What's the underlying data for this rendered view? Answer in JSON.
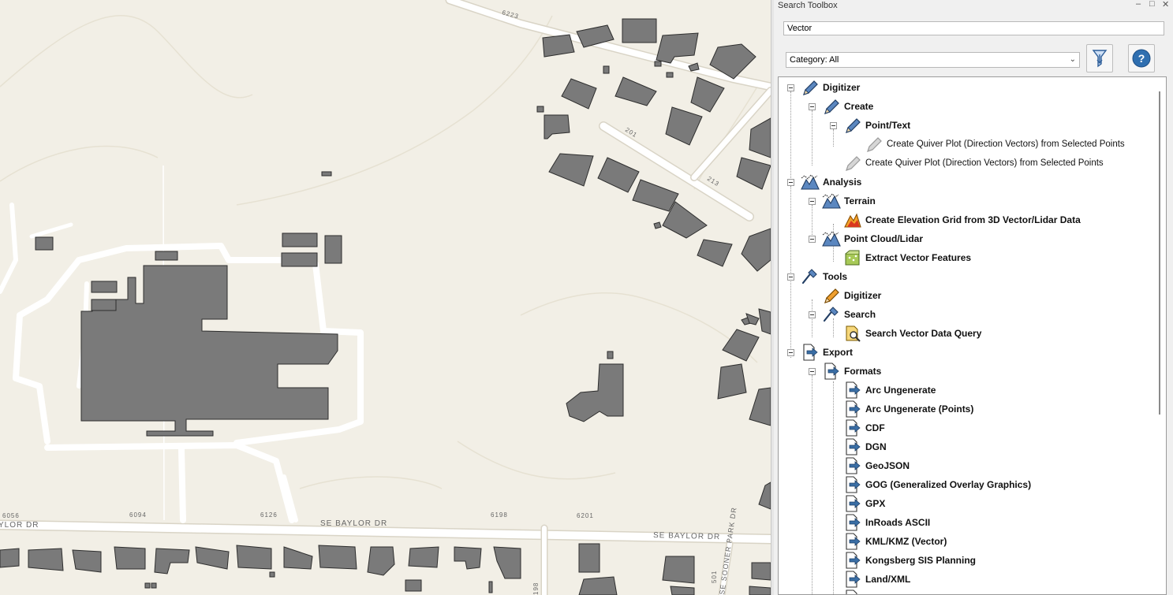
{
  "map": {
    "labels": {
      "street_top": "6223",
      "street_201": "201",
      "street_213": "213",
      "baylor_left": "YLOR DR",
      "baylor_mid": "SE BAYLOR DR",
      "baylor_right": "SE BAYLOR DR",
      "sooner_park": "SE SOONER PARK DR",
      "addr_6056": "6056",
      "addr_6094": "6094",
      "addr_6126": "6126",
      "addr_6198": "6198",
      "addr_6201": "6201",
      "addr_501": "501",
      "addr_198": "198"
    }
  },
  "panel": {
    "title": "Search Toolbox",
    "controls": {
      "minimize": "–",
      "maximize": "□",
      "close": "✕"
    },
    "search": {
      "value": "Vector"
    },
    "category": {
      "selected": "Category: All"
    },
    "buttons": {
      "filter_icon": "filter-icon",
      "help_icon": "help-icon"
    }
  },
  "tree": {
    "digitizer": "Digitizer",
    "create": "Create",
    "point_text": "Point/Text",
    "quiver_1": "Create Quiver Plot (Direction Vectors) from Selected Points",
    "quiver_2": "Create Quiver Plot (Direction Vectors) from Selected Points",
    "analysis": "Analysis",
    "terrain": "Terrain",
    "elev_grid": "Create Elevation Grid from 3D Vector/Lidar Data",
    "point_cloud": "Point Cloud/Lidar",
    "extract": "Extract Vector Features",
    "tools": "Tools",
    "tools_digitizer": "Digitizer",
    "tools_search": "Search",
    "search_query": "Search Vector Data Query",
    "export": "Export",
    "formats": "Formats",
    "fmt_arc": "Arc Ungenerate",
    "fmt_arc_points": "Arc Ungenerate (Points)",
    "fmt_cdf": "CDF",
    "fmt_dgn": "DGN",
    "fmt_geojson": "GeoJSON",
    "fmt_gog": "GOG (Generalized Overlay Graphics)",
    "fmt_gpx": "GPX",
    "fmt_inroads": "InRoads ASCII",
    "fmt_kml": "KML/KMZ (Vector)",
    "fmt_kongsberg": "Kongsberg SIS Planning",
    "fmt_landxml": "Land/XML"
  },
  "colors": {
    "map_bg": "#f2efe6",
    "building": "#7a7a7a",
    "road": "#ffffff",
    "panel_bg": "#f0f0f0"
  }
}
